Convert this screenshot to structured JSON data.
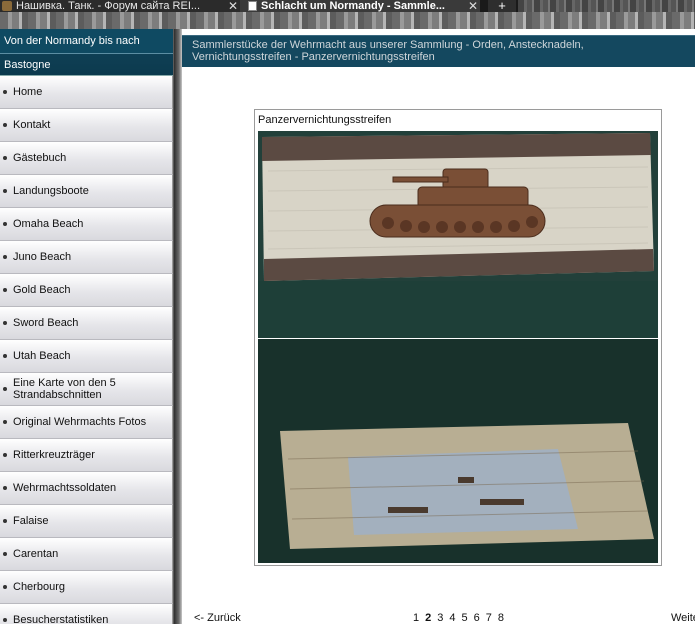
{
  "browser": {
    "tabs": [
      {
        "title": "Нашивка. Танк. - Форум сайта REI...",
        "close": "✕"
      },
      {
        "title": "Schlacht um Normandy - Sammle...",
        "close": "✕"
      }
    ],
    "new_tab": "+"
  },
  "sidebar": {
    "heading_line1": "Von der Normandy bis nach",
    "heading_line2": "Bastogne",
    "items": [
      {
        "label": "Home"
      },
      {
        "label": "Kontakt"
      },
      {
        "label": "Gästebuch"
      },
      {
        "label": "Landungsboote"
      },
      {
        "label": "Omaha Beach"
      },
      {
        "label": "Juno Beach"
      },
      {
        "label": "Gold Beach"
      },
      {
        "label": "Sword Beach"
      },
      {
        "label": "Utah Beach"
      },
      {
        "label": "Eine Karte von den 5 Strandabschnitten"
      },
      {
        "label": "Original Wehrmachts Fotos"
      },
      {
        "label": "Ritterkreuzträger"
      },
      {
        "label": "Wehrmachtssoldaten"
      },
      {
        "label": "Falaise"
      },
      {
        "label": "Carentan"
      },
      {
        "label": "Cherbourg"
      },
      {
        "label": "Besucherstatistiken"
      }
    ]
  },
  "main": {
    "title": "Sammlerstücke der Wehrmacht aus unserer Sammlung - Orden, Anstecknadeln, Vernichtungsstreifen - Panzervernichtungsstreifen",
    "photo_caption": "Panzervernichtungsstreifen",
    "pager": {
      "back": "<- Zurück",
      "pages": [
        "1",
        "2",
        "3",
        "4",
        "5",
        "6",
        "7",
        "8"
      ],
      "current": "2",
      "next": "Weiter"
    }
  }
}
